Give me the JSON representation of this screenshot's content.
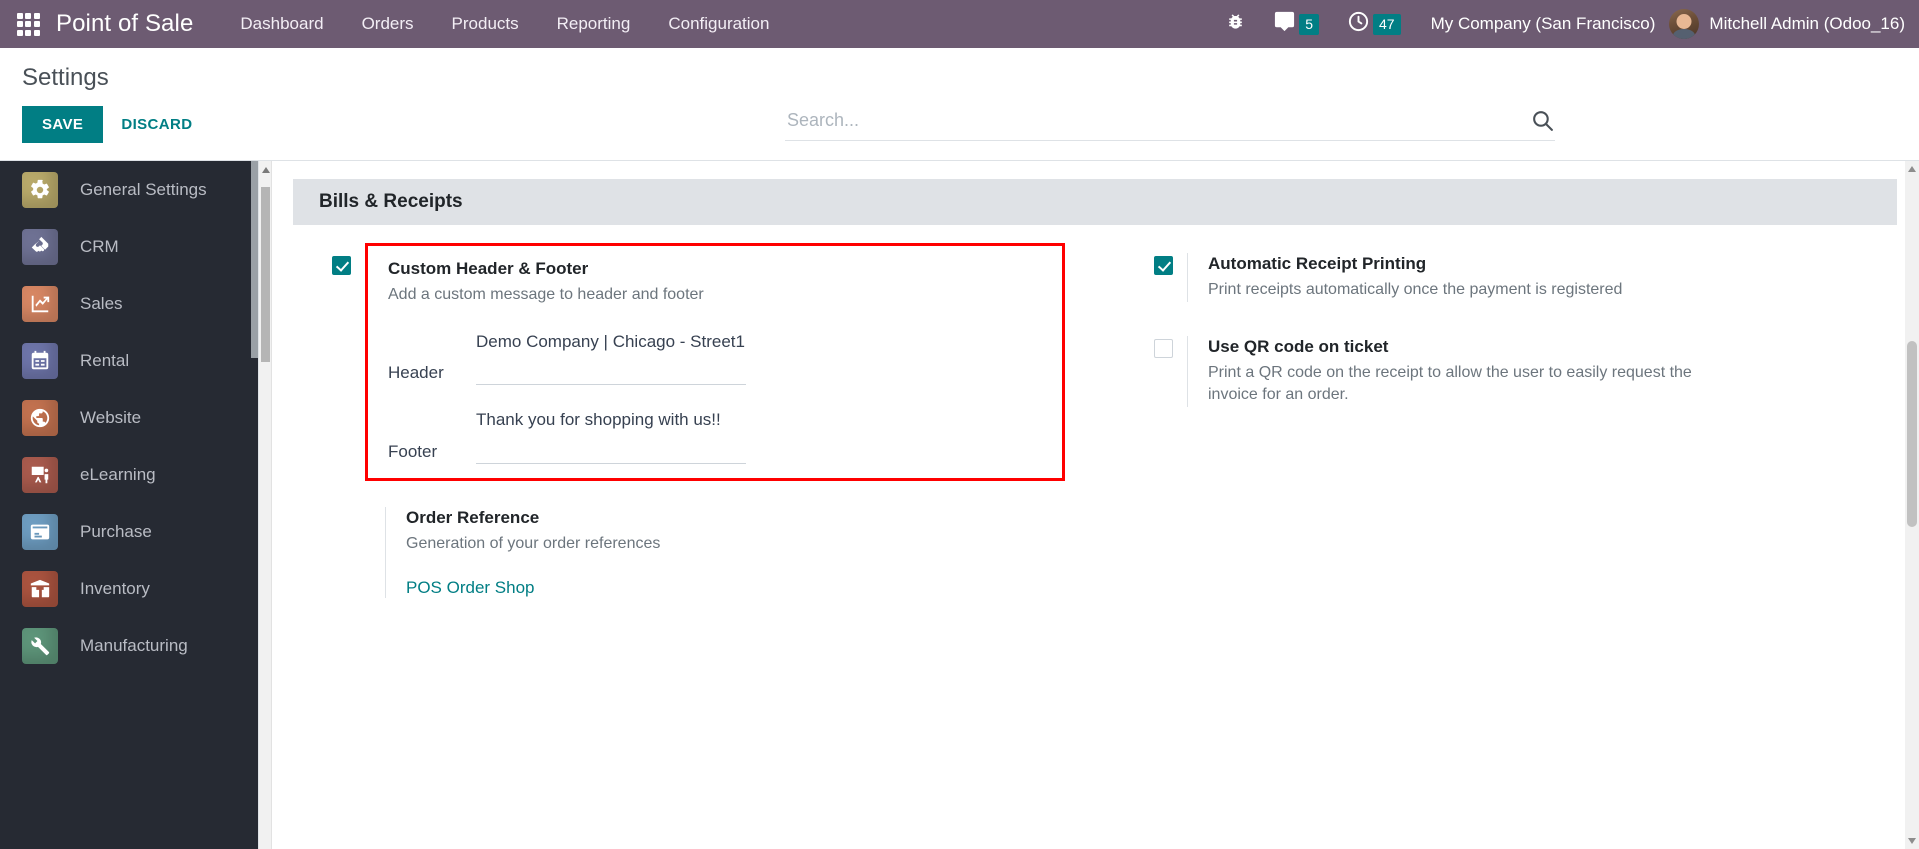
{
  "navbar": {
    "apps_icon": "grid-apps-icon",
    "brand": "Point of Sale",
    "items": [
      {
        "label": "Dashboard"
      },
      {
        "label": "Orders"
      },
      {
        "label": "Products"
      },
      {
        "label": "Reporting"
      },
      {
        "label": "Configuration"
      }
    ],
    "system": [
      {
        "icon": "bug-icon",
        "name": "debug-bug-icon",
        "badge": ""
      },
      {
        "icon": "chat-icon",
        "name": "messages-icon",
        "badge": "5"
      },
      {
        "icon": "clock-icon",
        "name": "activities-clock-icon",
        "badge": "47"
      }
    ],
    "company": "My Company (San Francisco)",
    "user": "Mitchell Admin (Odoo_16)",
    "accent_badge_color": "#017e84",
    "background_color": "#6d5b72"
  },
  "control_panel": {
    "title": "Settings",
    "save_label": "SAVE",
    "discard_label": "DISCARD",
    "search_placeholder": "Search...",
    "search_value": "",
    "search_icon": "magnifier-icon",
    "save_color": "#017e84"
  },
  "sidebar": {
    "items": [
      {
        "label": "General Settings",
        "icon": "gear-icon",
        "color": "#b8a96a"
      },
      {
        "label": "CRM",
        "icon": "handshake-icon",
        "color": "#6e7193"
      },
      {
        "label": "Sales",
        "icon": "chart-up-icon",
        "color": "#d68663"
      },
      {
        "label": "Rental",
        "icon": "calendar-icon",
        "color": "#6d74a8"
      },
      {
        "label": "Website",
        "icon": "globe-icon",
        "color": "#c1714f"
      },
      {
        "label": "eLearning",
        "icon": "presentation-icon",
        "color": "#a85a4d"
      },
      {
        "label": "Purchase",
        "icon": "card-icon",
        "color": "#6d9cc0"
      },
      {
        "label": "Inventory",
        "icon": "box-icon",
        "color": "#a9533f"
      },
      {
        "label": "Manufacturing",
        "icon": "wrench-icon",
        "color": "#5d9479"
      }
    ]
  },
  "main": {
    "section_title": "Bills & Receipts",
    "left_column": [
      {
        "id": "custom-header-footer",
        "title": "Custom Header & Footer",
        "description": "Add a custom message to header and footer",
        "checked": true,
        "highlighted": true,
        "fields": [
          {
            "label": "Header",
            "value": "Demo Company | Chicago - Street1"
          },
          {
            "label": "Footer",
            "value": "Thank you for shopping with us!!"
          }
        ]
      }
    ],
    "order_reference": {
      "title": "Order Reference",
      "description": "Generation of your order references",
      "link_label": "POS Order Shop"
    },
    "right_column": [
      {
        "id": "automatic-receipt-printing",
        "title": "Automatic Receipt Printing",
        "description": "Print receipts automatically once the payment is registered",
        "checked": true
      },
      {
        "id": "use-qr-code-on-ticket",
        "title": "Use QR code on ticket",
        "description": "Print a QR code on the receipt to allow the user to easily request the invoice for an order.",
        "checked": false
      }
    ],
    "highlight_color": "#ff0000",
    "link_color": "#017e84"
  }
}
